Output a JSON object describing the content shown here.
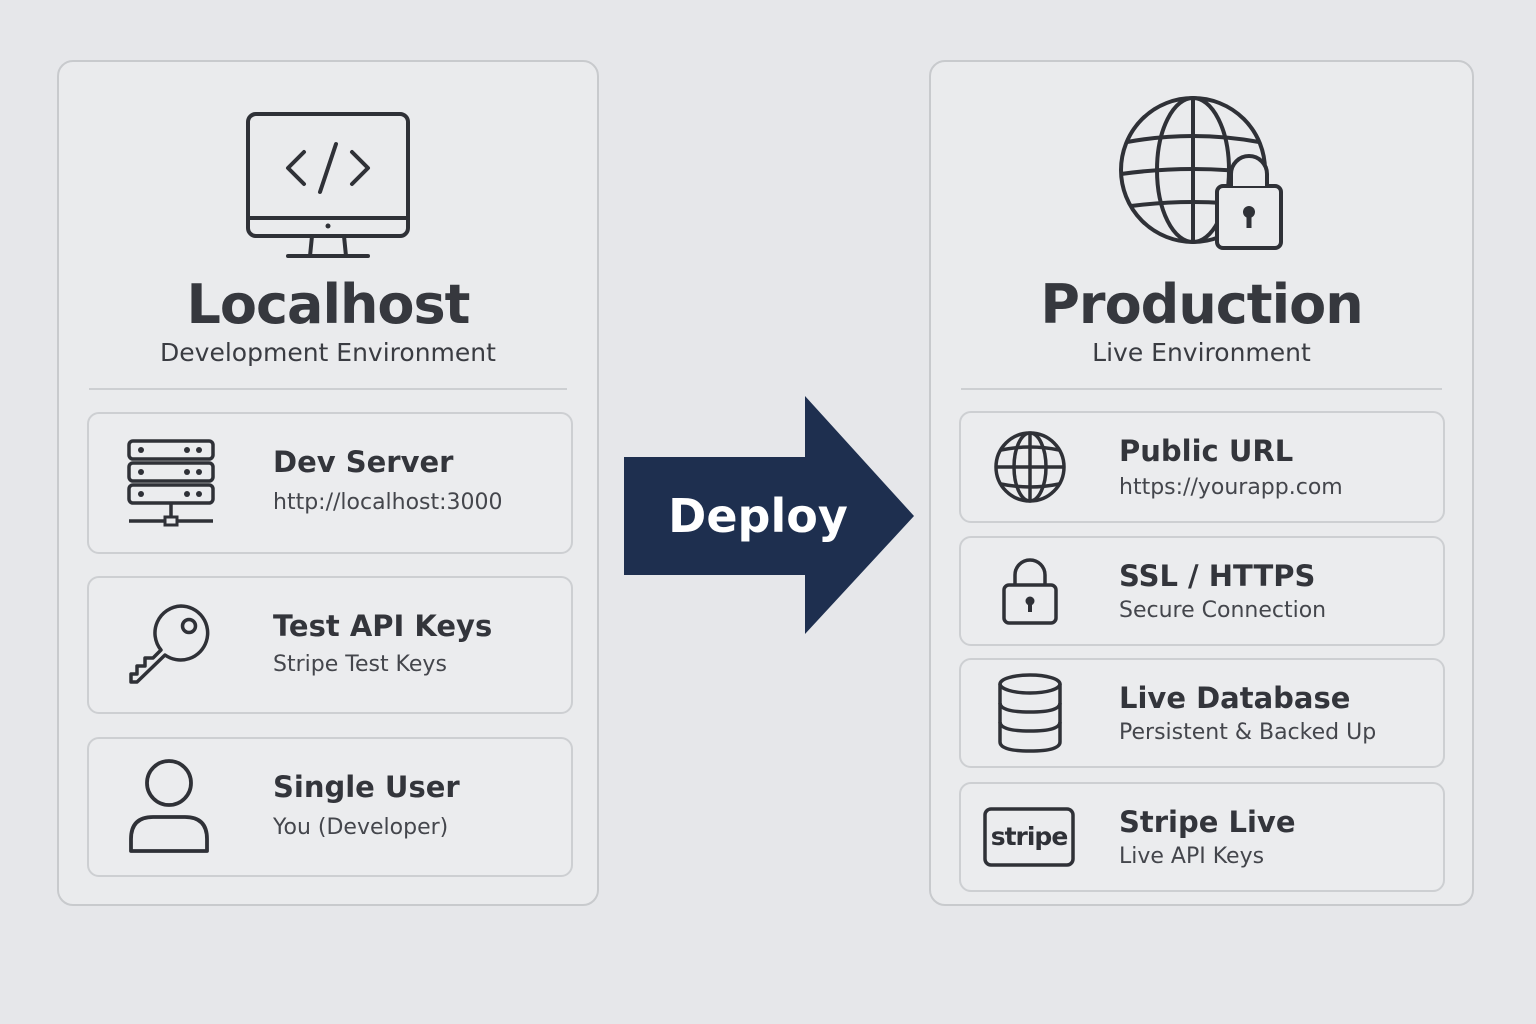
{
  "localhost": {
    "title": "Localhost",
    "subtitle": "Development Environment",
    "hero_icon": "monitor-code-icon",
    "items": [
      {
        "icon": "server-icon",
        "title": "Dev Server",
        "subtitle": "http://localhost:3000"
      },
      {
        "icon": "key-icon",
        "title": "Test API Keys",
        "subtitle": "Stripe Test Keys"
      },
      {
        "icon": "user-icon",
        "title": "Single User",
        "subtitle": "You (Developer)"
      }
    ]
  },
  "deploy": {
    "label": "Deploy",
    "color": "#1e2f4f"
  },
  "production": {
    "title": "Production",
    "subtitle": "Live Environment",
    "hero_icon": "globe-lock-icon",
    "items": [
      {
        "icon": "globe-icon",
        "title": "Public URL",
        "subtitle": "https://yourapp.com"
      },
      {
        "icon": "lock-icon",
        "title": "SSL / HTTPS",
        "subtitle": "Secure Connection"
      },
      {
        "icon": "database-icon",
        "title": "Live Database",
        "subtitle": "Persistent & Backed Up"
      },
      {
        "icon": "stripe-logo-icon",
        "title": "Stripe Live",
        "subtitle": "Live API Keys",
        "logo_text": "stripe"
      }
    ]
  }
}
